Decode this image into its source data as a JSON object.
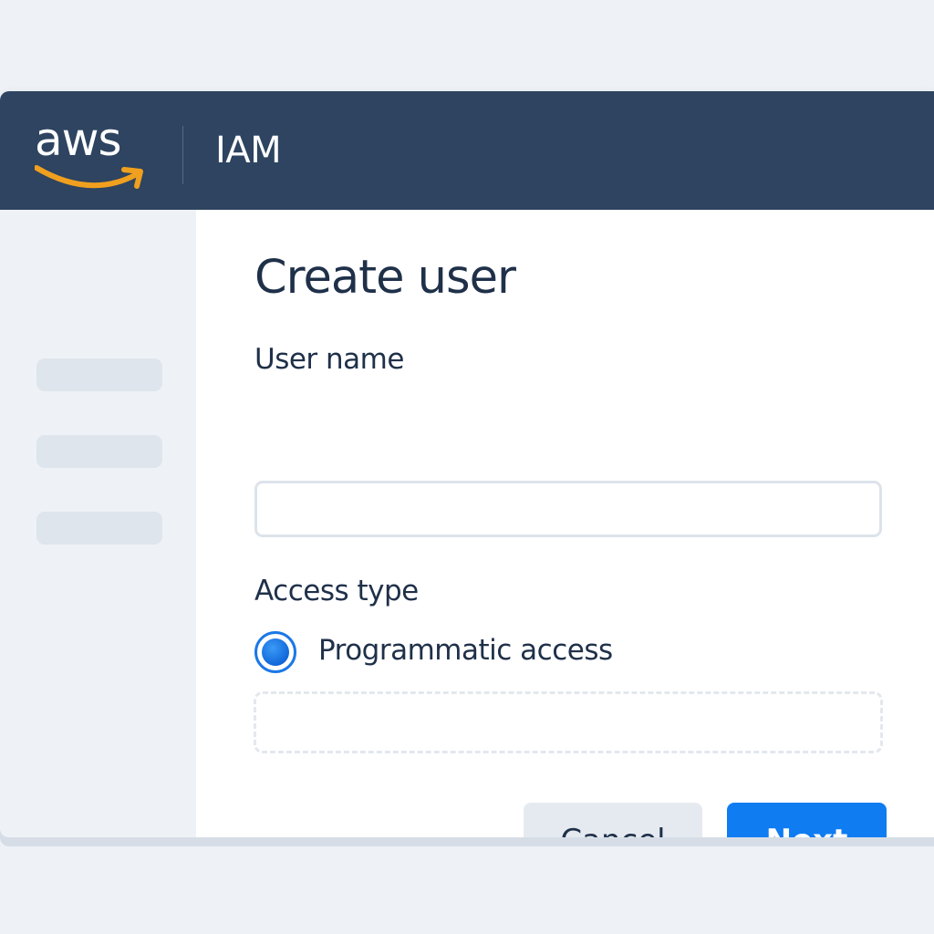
{
  "header": {
    "logo_text": "aws",
    "service_name": "IAM"
  },
  "sidebar": {
    "items": [
      {
        "label": ""
      },
      {
        "label": ""
      },
      {
        "label": ""
      }
    ]
  },
  "form": {
    "title": "Create user",
    "user_name": {
      "label": "User name",
      "value": "",
      "placeholder": ""
    },
    "access_type": {
      "label": "Access type",
      "option_label": "Programmatic access",
      "selected": true
    }
  },
  "actions": {
    "cancel_label": "Cancel",
    "next_label": "Next"
  },
  "colors": {
    "header_bg": "#2e4460",
    "aws_orange": "#f0a01e",
    "primary": "#0f7cf2",
    "text": "#1f3049",
    "page_bg": "#eef2f6"
  }
}
